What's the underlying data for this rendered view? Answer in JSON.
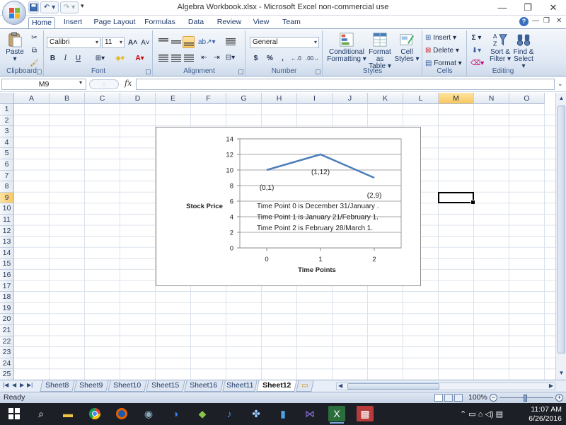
{
  "window": {
    "title": "Algebra Workbook.xlsx - Microsoft Excel non-commercial use",
    "minimize": "—",
    "restore": "❐",
    "close": "✕",
    "qat_undo": "↶ ▾",
    "qat_redo": "↷ ▾",
    "qat_more": "▾"
  },
  "ribbon_tabs": [
    "Home",
    "Insert",
    "Page Layout",
    "Formulas",
    "Data",
    "Review",
    "View",
    "Team"
  ],
  "ribbon": {
    "help": "?",
    "doc_min": "—",
    "doc_restore": "❐",
    "doc_close": "✕",
    "clipboard": {
      "label": "Clipboard",
      "paste": "Paste"
    },
    "font": {
      "label": "Font",
      "name": "Calibri",
      "size": "11",
      "bold": "B",
      "italic": "I",
      "underline": "U",
      "grow": "A˄",
      "shrink": "A˅"
    },
    "alignment": {
      "label": "Alignment"
    },
    "number": {
      "label": "Number",
      "format": "General",
      "currency": "$",
      "percent": "%",
      "comma": ",",
      "inc_dec": "←.0",
      "dec_dec": ".00→"
    },
    "styles": {
      "label": "Styles",
      "conditional": "Conditional",
      "conditional2": "Formatting ▾",
      "format_table": "Format",
      "format_table2": "as Table ▾",
      "cell_styles": "Cell",
      "cell_styles2": "Styles ▾"
    },
    "cells": {
      "label": "Cells",
      "insert": "Insert ▾",
      "delete": "Delete ▾",
      "format": "Format ▾"
    },
    "editing": {
      "label": "Editing",
      "sum": "Σ ▾",
      "sort": "Sort &",
      "sort2": "Filter ▾",
      "find": "Find &",
      "find2": "Select ▾"
    }
  },
  "formula_bar": {
    "name_box": "M9",
    "fx": "fx",
    "value": ""
  },
  "columns": [
    "A",
    "B",
    "C",
    "D",
    "E",
    "F",
    "G",
    "H",
    "I",
    "J",
    "K",
    "L",
    "M",
    "N",
    "O"
  ],
  "selected_column": "M",
  "selected_row": 9,
  "rows": [
    1,
    2,
    3,
    4,
    5,
    6,
    7,
    8,
    9,
    10,
    11,
    12,
    13,
    14,
    15,
    16,
    17,
    18,
    19,
    20,
    21,
    22,
    23,
    24,
    25
  ],
  "chart_data": {
    "type": "line",
    "x": [
      0,
      1,
      2
    ],
    "series": [
      {
        "values": [
          10,
          12,
          9
        ],
        "color": "#4a7ebb"
      }
    ],
    "point_labels": [
      "(0,1)",
      "(1,12)",
      "(2,9)"
    ],
    "xlabel": "Time Points",
    "ylabel": "Stock Price",
    "ylim": [
      0,
      14
    ],
    "yticks": [
      0,
      2,
      4,
      6,
      8,
      10,
      12,
      14
    ],
    "xticks": [
      "0",
      "1",
      "2"
    ],
    "grid": true,
    "annotations": [
      "Time Point 0 is December 31/January .",
      "Time Point 1 is January 21/February 1.",
      "Time Point 2 is February 28/March 1."
    ]
  },
  "sheet_tabs": [
    "Sheet8",
    "Sheet9",
    "Sheet10",
    "Sheet15",
    "Sheet16",
    "Sheet11",
    "Sheet12"
  ],
  "active_sheet": "Sheet12",
  "status": {
    "ready": "Ready",
    "zoom": "100%"
  },
  "taskbar": {
    "time": "11:07 AM",
    "date": "6/26/2016"
  }
}
